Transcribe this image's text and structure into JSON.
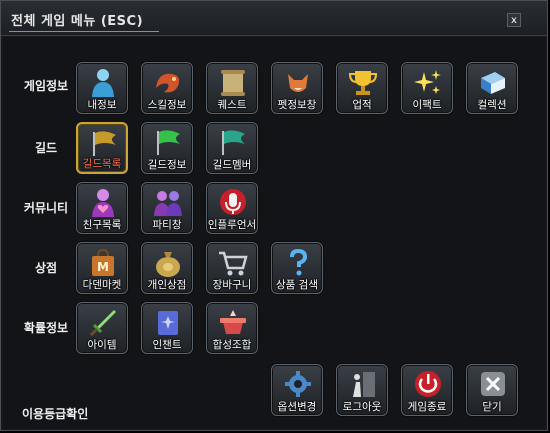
{
  "window": {
    "title": "전체 게임 메뉴 (ESC)",
    "close_glyph": "x"
  },
  "categories": {
    "game_info": "게임정보",
    "guild": "길드",
    "community": "커뮤니티",
    "shop": "상점",
    "probability": "확률정보",
    "rating": "이용등급확인"
  },
  "game_info_buttons": [
    "내정보",
    "스킬정보",
    "퀘스트",
    "펫정보창",
    "업적",
    "이팩트",
    "컬렉션"
  ],
  "guild_buttons": [
    "길드목록",
    "길드정보",
    "길드멤버"
  ],
  "community_buttons": [
    "친구목록",
    "파티창",
    "인플루언서"
  ],
  "shop_buttons": [
    "다덴마켓",
    "개인상점",
    "장바구니",
    "상품 검색"
  ],
  "probability_buttons": [
    "아이템",
    "인챈트",
    "합성조합"
  ],
  "system_buttons": [
    "옵션변경",
    "로그아웃",
    "게임종료",
    "닫기"
  ],
  "shop_icon_letter": "M",
  "colors": {
    "selected_border": "#c9a53a",
    "selected_label": "#ff6a4a"
  }
}
